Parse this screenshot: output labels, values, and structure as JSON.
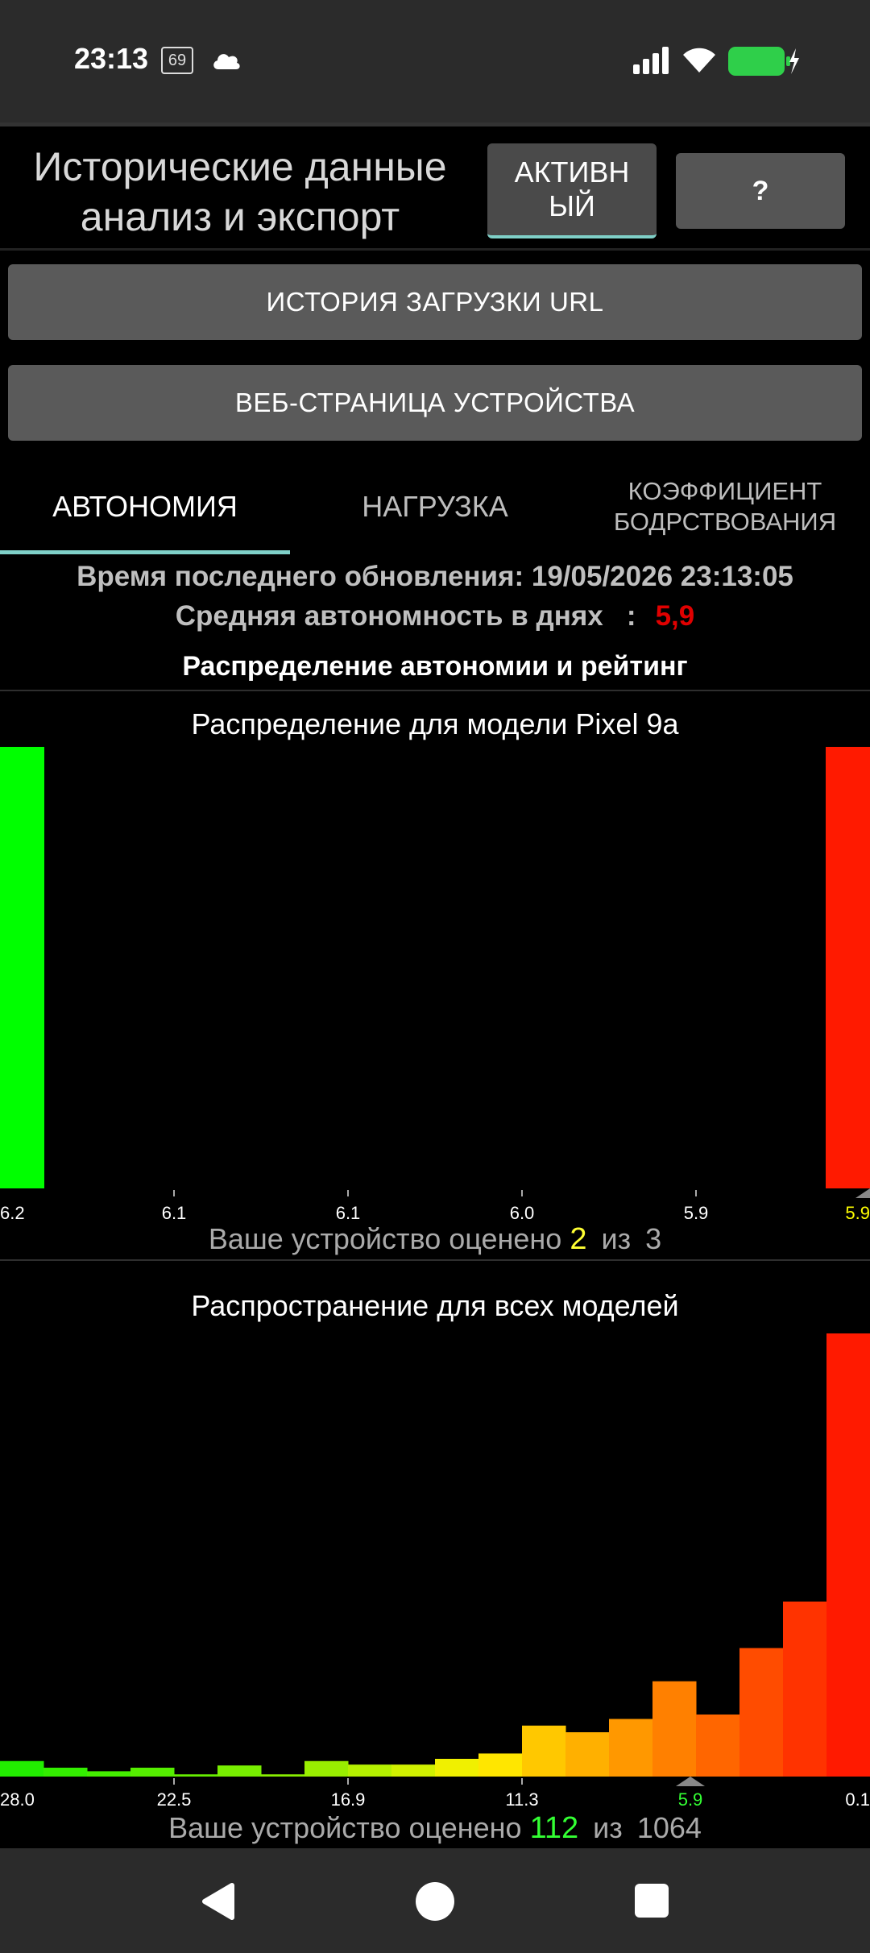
{
  "status_bar": {
    "time": "23:13",
    "badge": "69"
  },
  "header": {
    "title_line1": "Исторические данные",
    "title_line2": "анализ и экспорт",
    "active_button": "АКТИВНЫЙ",
    "help_button": "?"
  },
  "buttons": {
    "url_history": "ИСТОРИЯ ЗАГРУЗКИ URL",
    "device_web": "ВЕБ-СТРАНИЦА УСТРОЙСТВА"
  },
  "tabs": [
    {
      "label": "АВТОНОМИЯ"
    },
    {
      "label": "НАГРУЗКА"
    },
    {
      "label": "КОЭФФИЦИЕНТ БОДРСТВОВАНИЯ"
    }
  ],
  "info": {
    "last_update": "Время последнего обновления: 19/05/2026 23:13:05",
    "avg_label": "Средняя автономность в днях   :",
    "avg_value": "5,9",
    "section_title": "Распределение автономии и рейтинг"
  },
  "chart_data": [
    {
      "type": "bar",
      "title": "Распределение для модели Pixel 9a",
      "tick_labels": [
        "6.2",
        "6.1",
        "6.1",
        "6.0",
        "5.9",
        "5.9"
      ],
      "values": [
        1,
        0,
        0,
        0,
        0,
        1
      ],
      "bar_colors": [
        "#00ff00",
        "#00ff00",
        "#00ff00",
        "#00ff00",
        "#00ff00",
        "#ff1a00"
      ],
      "marker_label": "5.9",
      "marker_color": "#ffff00",
      "rank_prefix": "Ваше устройство оценено",
      "rank": "2",
      "rank_color": "#ffff33",
      "rank_sep": "из",
      "total": "3"
    },
    {
      "type": "bar",
      "title": "Распространение для всех моделей",
      "tick_labels": [
        "28.0",
        "22.5",
        "16.9",
        "11.3",
        "5.9",
        "0.1"
      ],
      "values": [
        3.5,
        2,
        1.2,
        2,
        0.5,
        2.5,
        0.5,
        3.5,
        2.7,
        2.7,
        4,
        5.2,
        11.5,
        10,
        13,
        21.5,
        14,
        29,
        39.5,
        100
      ],
      "bar_colors": [
        "#22ee00",
        "#33ee00",
        "#44ee00",
        "#55ee00",
        "#66ee00",
        "#77ee00",
        "#88ee00",
        "#99ee00",
        "#b5f000",
        "#d0f000",
        "#f0f000",
        "#ffe600",
        "#ffc800",
        "#ffb000",
        "#ff9800",
        "#ff8000",
        "#ff6600",
        "#ff4c00",
        "#ff3300",
        "#ff1a00"
      ],
      "marker_label": "5.9",
      "marker_color": "#33ff33",
      "rank_prefix": "Ваше устройство оценено",
      "rank": "112",
      "rank_color": "#33ff33",
      "rank_sep": "из",
      "total": "1064"
    }
  ]
}
